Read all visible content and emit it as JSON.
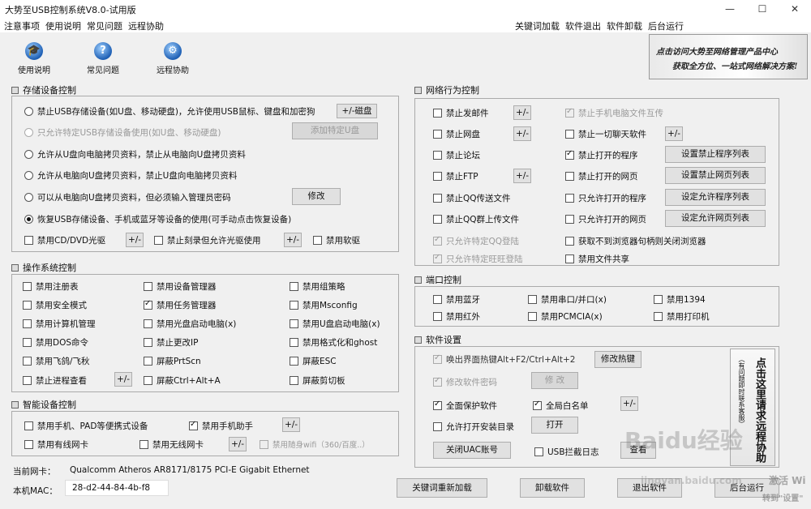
{
  "title": "大势至USB控制系统V8.0-试用版",
  "window_controls": {
    "min": "—",
    "max": "☐",
    "close": "✕"
  },
  "menu": {
    "left": [
      "注意事项",
      "使用说明",
      "常见问题",
      "远程协助"
    ],
    "right": [
      "关键词加载",
      "软件退出",
      "软件卸载",
      "后台运行"
    ]
  },
  "toolbar": [
    {
      "label": "使用说明",
      "icon": "graduation-cap-icon",
      "glyph": "🎓"
    },
    {
      "label": "常见问题",
      "icon": "question-icon",
      "glyph": "?"
    },
    {
      "label": "远程协助",
      "icon": "remote-icon",
      "glyph": "⚙"
    }
  ],
  "banner": {
    "line1": "点击访问大势至网络管理产品中心",
    "line2": "获取全方位、一站式网络解决方案!"
  },
  "storage": {
    "title": "存储设备控制",
    "options": [
      {
        "label": "禁止USB存储设备(如U盘、移动硬盘)，允许使用USB鼠标、键盘和加密狗",
        "checked": false,
        "disabled": false
      },
      {
        "label": "只允许特定USB存储设备使用(如U盘、移动硬盘)",
        "checked": false,
        "disabled": true
      },
      {
        "label": "允许从U盘向电脑拷贝资料，禁止从电脑向U盘拷贝资料",
        "checked": false,
        "disabled": false
      },
      {
        "label": "允许从电脑向U盘拷贝资料，禁止U盘向电脑拷贝资料",
        "checked": false,
        "disabled": false
      },
      {
        "label": "可以从电脑向U盘拷贝资料，但必须输入管理员密码",
        "checked": false,
        "disabled": false
      },
      {
        "label": "恢复USB存储设备、手机或蓝牙等设备的使用(可手动点击恢复设备)",
        "checked": true,
        "disabled": false
      }
    ],
    "btn_disk": "+/-磁盘",
    "btn_add_u": "添加特定U盘",
    "btn_modify": "修改",
    "cd": {
      "label": "禁用CD/DVD光驱",
      "checked": false
    },
    "burn": {
      "label": "禁止刻录但允许光驱使用",
      "checked": false
    },
    "floppy": {
      "label": "禁用软驱",
      "checked": false
    },
    "pm": "+/-"
  },
  "os": {
    "title": "操作系统控制",
    "items": [
      {
        "label": "禁用注册表",
        "checked": false
      },
      {
        "label": "禁用设备管理器",
        "checked": false
      },
      {
        "label": "禁用组策略",
        "checked": false
      },
      {
        "label": "禁用安全模式",
        "checked": false
      },
      {
        "label": "禁用任务管理器",
        "checked": true
      },
      {
        "label": "禁用Msconfig",
        "checked": false
      },
      {
        "label": "禁用计算机管理",
        "checked": false
      },
      {
        "label": "禁用光盘启动电脑(x)",
        "checked": false
      },
      {
        "label": "禁用U盘启动电脑(x)",
        "checked": false
      },
      {
        "label": "禁用DOS命令",
        "checked": false
      },
      {
        "label": "禁止更改IP",
        "checked": false
      },
      {
        "label": "禁用格式化和ghost",
        "checked": false
      },
      {
        "label": "禁用飞鸽/飞秋",
        "checked": false
      },
      {
        "label": "屏蔽PrtScn",
        "checked": false
      },
      {
        "label": "屏蔽ESC",
        "checked": false
      },
      {
        "label": "禁止进程查看",
        "checked": false
      },
      {
        "label": "屏蔽Ctrl+Alt+A",
        "checked": false
      },
      {
        "label": "屏蔽剪切板",
        "checked": false
      }
    ],
    "pm": "+/-"
  },
  "smart": {
    "title": "智能设备控制",
    "items": [
      {
        "label": "禁用手机、PAD等便携式设备",
        "checked": false
      },
      {
        "label": "禁用手机助手",
        "checked": true
      },
      {
        "label": "禁用有线网卡",
        "checked": false
      },
      {
        "label": "禁用无线网卡",
        "checked": false
      },
      {
        "label": "禁用随身wifi（360/百度..）",
        "checked": false,
        "disabled": true
      }
    ],
    "pm": "+/-"
  },
  "info": {
    "nic_label": "当前网卡：",
    "nic_value": "Qualcomm Atheros AR8171/8175 PCI-E Gigabit Ethernet",
    "mac_label": "本机MAC：",
    "mac_value": "28-d2-44-84-4b-f8"
  },
  "network": {
    "title": "网络行为控制",
    "left": [
      {
        "label": "禁止发邮件",
        "checked": false,
        "pm": true
      },
      {
        "label": "禁止网盘",
        "checked": false,
        "pm": true
      },
      {
        "label": "禁止论坛",
        "checked": false
      },
      {
        "label": "禁止FTP",
        "checked": false,
        "pm": true
      },
      {
        "label": "禁止QQ传送文件",
        "checked": false
      },
      {
        "label": "禁止QQ群上传文件",
        "checked": false
      },
      {
        "label": "只允许特定QQ登陆",
        "checked": true,
        "disabled": true
      },
      {
        "label": "只允许特定旺旺登陆",
        "checked": true,
        "disabled": true
      }
    ],
    "right": [
      {
        "label": "禁止手机电脑文件互传",
        "checked": true,
        "disabled": true
      },
      {
        "label": "禁止一切聊天软件",
        "checked": false,
        "pm": true
      },
      {
        "label": "禁止打开的程序",
        "checked": true,
        "btn": "设置禁止程序列表"
      },
      {
        "label": "禁止打开的网页",
        "checked": false,
        "btn": "设置禁止网页列表"
      },
      {
        "label": "只允许打开的程序",
        "checked": false,
        "btn": "设定允许程序列表"
      },
      {
        "label": "只允许打开的网页",
        "checked": false,
        "btn": "设定允许网页列表"
      },
      {
        "label": "获取不到浏览器句柄则关闭浏览器",
        "checked": false
      },
      {
        "label": "禁用文件共享",
        "checked": false
      }
    ],
    "pm": "+/-"
  },
  "port": {
    "title": "端口控制",
    "items": [
      {
        "label": "禁用蓝牙",
        "checked": false
      },
      {
        "label": "禁用串口/并口(x)",
        "checked": false
      },
      {
        "label": "禁用1394",
        "checked": false
      },
      {
        "label": "禁用红外",
        "checked": false
      },
      {
        "label": "禁用PCMCIA(x)",
        "checked": false
      },
      {
        "label": "禁用打印机",
        "checked": false
      }
    ]
  },
  "software": {
    "title": "软件设置",
    "hotkey": {
      "label": "唤出界面热键Alt+F2/Ctrl+Alt+2",
      "checked": true,
      "disabled": true
    },
    "btn_hotkey": "修改热键",
    "pwd": {
      "label": "修改软件密码",
      "checked": true,
      "disabled": true
    },
    "btn_pwd": "修 改",
    "protect": {
      "label": "全面保护软件",
      "checked": true
    },
    "whitelist": {
      "label": "全局白名单",
      "checked": true
    },
    "pm": "+/-",
    "autostart": {
      "label": "允许打开安装目录",
      "checked": false
    },
    "btn_open": "打开",
    "btn_uac": "关闭UAC账号",
    "usblog": {
      "label": "USB拦截日志",
      "checked": false
    },
    "btn_log_partial": "查看"
  },
  "scroll_text": [
    "点击这里请求远程协助",
    "（有问题即时联系客服）"
  ],
  "bottom": {
    "reload": "关键词重新加载",
    "uninstall": "卸载软件",
    "exit": "退出软件",
    "background": "后台运行"
  },
  "watermark": {
    "logo": "Baidu经验",
    "url": "jingyan.baidu.com",
    "activate": "激活 Wi",
    "settings": "转到\"设置\""
  }
}
